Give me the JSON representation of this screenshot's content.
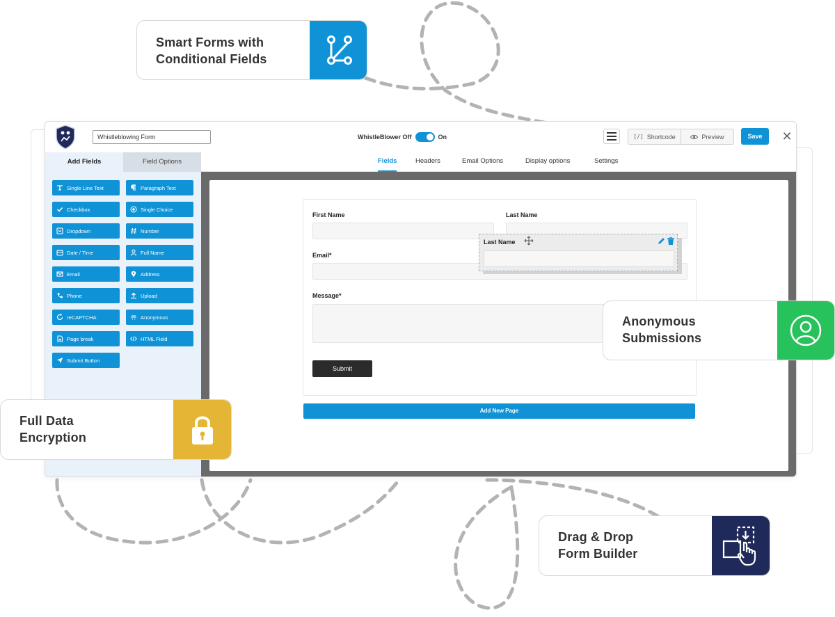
{
  "app": {
    "form_title": "Whistleblowing Form",
    "toggle_off_label": "WhistleBlower Off",
    "toggle_on_label": "On",
    "shortcode_label": "Shortcode",
    "shortcode_icon_text": "[/]",
    "preview_label": "Preview",
    "save_label": "Save",
    "close_label": "✕"
  },
  "sidebar": {
    "tabs": [
      {
        "label": "Add Fields",
        "active": true
      },
      {
        "label": "Field Options",
        "active": false
      }
    ],
    "fields": [
      {
        "label": "Single Line Text",
        "icon": "text-line-icon"
      },
      {
        "label": "Paragraph Text",
        "icon": "paragraph-icon"
      },
      {
        "label": "Checkbox",
        "icon": "check-icon"
      },
      {
        "label": "Single Choice",
        "icon": "radio-icon"
      },
      {
        "label": "Dropdown",
        "icon": "dropdown-icon"
      },
      {
        "label": "Number",
        "icon": "hash-icon"
      },
      {
        "label": "Date / Time",
        "icon": "calendar-icon"
      },
      {
        "label": "Full Name",
        "icon": "user-icon"
      },
      {
        "label": "Email",
        "icon": "envelope-icon"
      },
      {
        "label": "Address",
        "icon": "map-pin-icon"
      },
      {
        "label": "Phone",
        "icon": "phone-icon"
      },
      {
        "label": "Upload",
        "icon": "upload-icon"
      },
      {
        "label": "reCAPTCHA",
        "icon": "recaptcha-icon"
      },
      {
        "label": "Anonymous",
        "icon": "anonymous-icon"
      },
      {
        "label": "Page break",
        "icon": "page-icon"
      },
      {
        "label": "HTML Field",
        "icon": "code-icon"
      },
      {
        "label": "Submit Button",
        "icon": "send-icon"
      }
    ]
  },
  "main_tabs": [
    {
      "label": "Fields",
      "active": true
    },
    {
      "label": "Headers",
      "active": false
    },
    {
      "label": "Email Options",
      "active": false
    },
    {
      "label": "Display options",
      "active": false
    },
    {
      "label": "Settings",
      "active": false
    }
  ],
  "form": {
    "first_name_label": "First Name",
    "last_name_label": "Last Name",
    "email_label": "Email*",
    "message_label": "Message*",
    "submit_label": "Submit",
    "dragging_label": "Last Name",
    "add_page_label": "Add New Page"
  },
  "callouts": {
    "smart_forms": {
      "line1": "Smart Forms with",
      "line2": "Conditional Fields",
      "color": "#0f92d6"
    },
    "anonymous": {
      "line1": "Anonymous",
      "line2": "Submissions",
      "color": "#27c25c"
    },
    "encryption": {
      "line1": "Full Data",
      "line2": "Encryption",
      "color": "#e5b535"
    },
    "drag_drop": {
      "line1": "Drag & Drop",
      "line2": "Form Builder",
      "color": "#1f2a5a"
    }
  },
  "colors": {
    "accent": "#0f92d6",
    "canvas_frame": "#6a6a6a",
    "sidebar_bg": "#e9f1fa",
    "dashed_line": "#b3b3b3"
  }
}
